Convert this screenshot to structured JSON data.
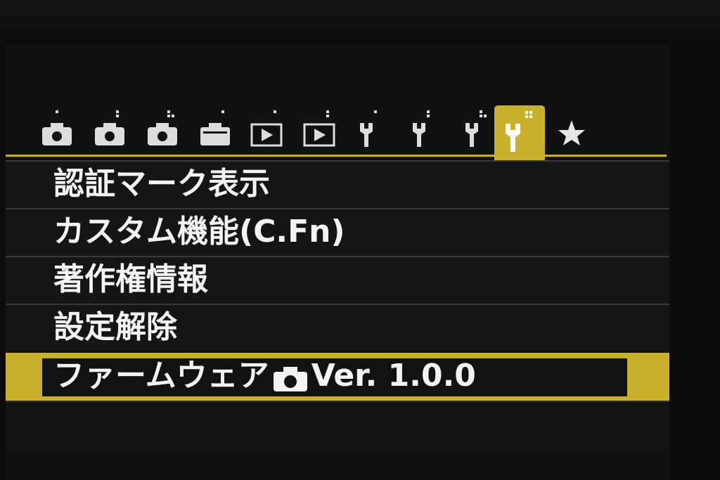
{
  "menu": {
    "items": [
      {
        "label": "認証マーク表示"
      },
      {
        "label": "カスタム機能(C.Fn)"
      },
      {
        "label": "著作権情報"
      },
      {
        "label": "設定解除"
      }
    ],
    "firmware": {
      "prefix": "ファームウェア",
      "icon": "camera-icon",
      "version": "Ver. 1.0.0"
    }
  },
  "tabs": [
    {
      "icon": "shooting-tab-1-icon"
    },
    {
      "icon": "shooting-tab-2-icon"
    },
    {
      "icon": "shooting-tab-3-icon"
    },
    {
      "icon": "shooting-tab-4-icon"
    },
    {
      "icon": "playback-tab-1-icon"
    },
    {
      "icon": "playback-tab-2-icon"
    },
    {
      "icon": "setup-tab-1-icon"
    },
    {
      "icon": "setup-tab-2-icon"
    },
    {
      "icon": "setup-tab-3-icon"
    },
    {
      "icon": "setup-tab-4-icon",
      "active": true
    },
    {
      "icon": "my-menu-star-icon"
    }
  ],
  "colors": {
    "accent": "#c9b12c",
    "background": "#101112",
    "text": "#f4f4f4"
  }
}
